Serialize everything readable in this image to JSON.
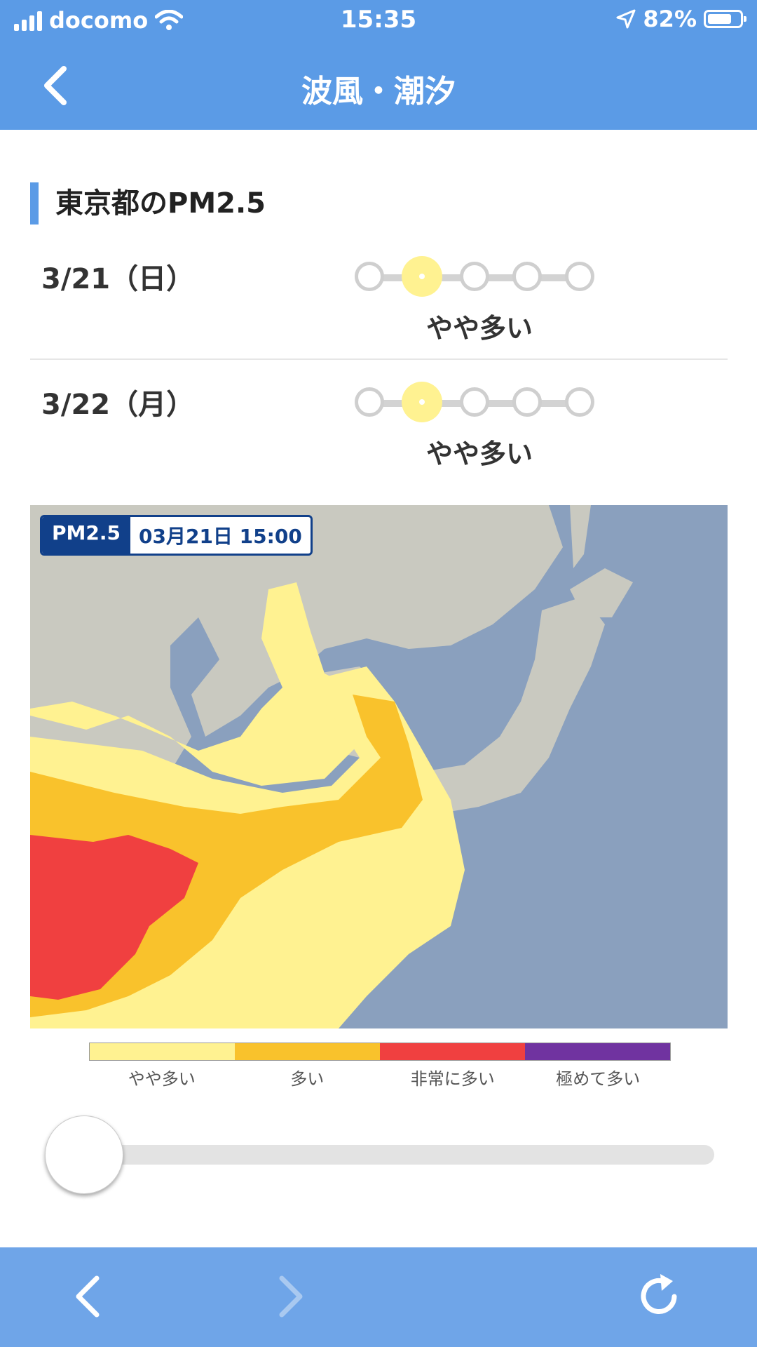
{
  "status_bar": {
    "carrier": "docomo",
    "time": "15:35",
    "battery": "82%",
    "battery_level": 0.82,
    "icons": [
      "signal-icon",
      "wifi-icon",
      "location-arrow-icon",
      "battery-icon"
    ]
  },
  "header": {
    "title": "波風・潮汐",
    "back_icon": "chevron-left-icon"
  },
  "section": {
    "title": "東京都のPM2.5"
  },
  "days": [
    {
      "date": "3/21（日）",
      "level_index": 1,
      "level_count": 5,
      "level_label": "やや多い"
    },
    {
      "date": "3/22（月）",
      "level_index": 1,
      "level_count": 5,
      "level_label": "やや多い"
    }
  ],
  "map": {
    "badge_label": "PM2.5",
    "badge_time": "03月21日 15:00"
  },
  "legend": [
    {
      "label": "やや多い",
      "color": "#fff291"
    },
    {
      "label": "多い",
      "color": "#f9c22c"
    },
    {
      "label": "非常に多い",
      "color": "#f04040"
    },
    {
      "label": "極めて多い",
      "color": "#7033a0"
    }
  ],
  "colors": {
    "accent": "#5b9be6",
    "sea": "#8aa0be",
    "land": "#c9c9c0",
    "toolbar": "#6fa5e8"
  },
  "slider": {
    "position": 0
  },
  "toolbar": {
    "back_icon": "chevron-left-icon",
    "forward_icon": "chevron-right-icon",
    "reload_icon": "reload-icon",
    "forward_enabled": false
  }
}
